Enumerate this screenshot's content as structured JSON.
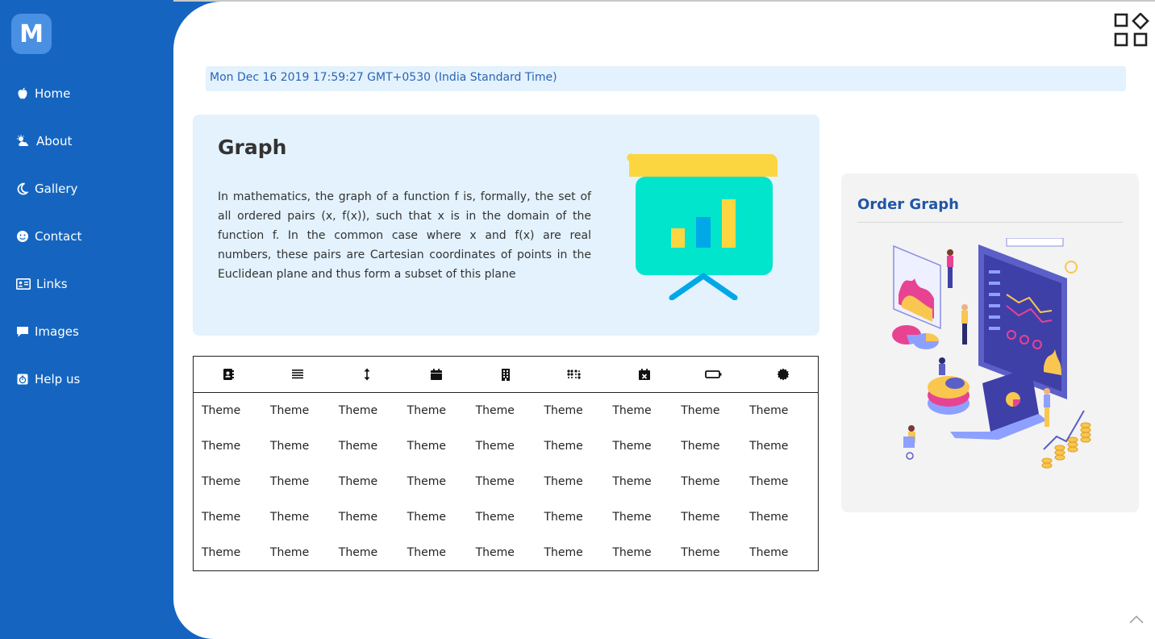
{
  "logo": {
    "letter": "M"
  },
  "nav": [
    {
      "label": "Home",
      "icon": "apple-icon"
    },
    {
      "label": "About",
      "icon": "cloud-sun-icon"
    },
    {
      "label": "Gallery",
      "icon": "moon-icon"
    },
    {
      "label": "Contact",
      "icon": "smile-icon"
    },
    {
      "label": "Links",
      "icon": "id-card-icon"
    },
    {
      "label": "Images",
      "icon": "comment-icon"
    },
    {
      "label": "Help us",
      "icon": "stopwatch-icon"
    }
  ],
  "date_text": "Mon Dec 16 2019 17:59:27 GMT+0530 (India Standard Time)",
  "graph": {
    "title": "Graph",
    "text": "In mathematics, the graph of a function f is, formally, the set of all ordered pairs (x, f(x)), such that x is in the domain of the function f. In the common case where x and f(x) are real numbers, these pairs are Cartesian coordinates of points in the Euclidean plane and thus form a subset of this plane"
  },
  "table": {
    "header_icons": [
      "address-book-icon",
      "align-justify-icon",
      "arrows-vertical-icon",
      "calendar-icon",
      "building-icon",
      "braille-icon",
      "calendar-times-icon",
      "battery-empty-icon",
      "certificate-icon"
    ],
    "rows": [
      [
        "Theme",
        "Theme",
        "Theme",
        "Theme",
        "Theme",
        "Theme",
        "Theme",
        "Theme",
        "Theme"
      ],
      [
        "Theme",
        "Theme",
        "Theme",
        "Theme",
        "Theme",
        "Theme",
        "Theme",
        "Theme",
        "Theme"
      ],
      [
        "Theme",
        "Theme",
        "Theme",
        "Theme",
        "Theme",
        "Theme",
        "Theme",
        "Theme",
        "Theme"
      ],
      [
        "Theme",
        "Theme",
        "Theme",
        "Theme",
        "Theme",
        "Theme",
        "Theme",
        "Theme",
        "Theme"
      ],
      [
        "Theme",
        "Theme",
        "Theme",
        "Theme",
        "Theme",
        "Theme",
        "Theme",
        "Theme",
        "Theme"
      ]
    ]
  },
  "order_graph": {
    "title": "Order Graph"
  },
  "colors": {
    "sidebar": "#1565c0",
    "accent": "#1f56a6",
    "light_blue": "#e3f2fd",
    "card_grey": "#f3f3f3"
  }
}
